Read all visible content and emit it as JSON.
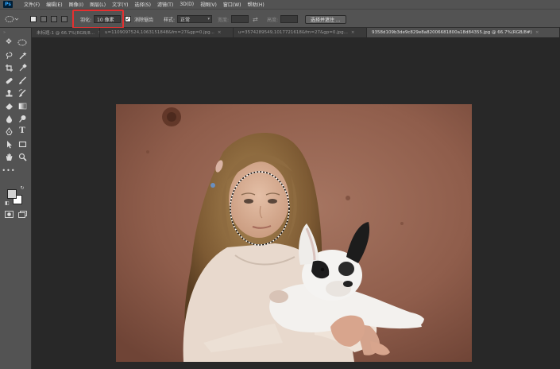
{
  "menu": {
    "app_logo": "Ps",
    "items": [
      "文件(F)",
      "编辑(E)",
      "图像(I)",
      "图层(L)",
      "文字(Y)",
      "选择(S)",
      "滤镜(T)",
      "3D(D)",
      "视图(V)",
      "窗口(W)",
      "帮助(H)"
    ]
  },
  "options": {
    "feather_label": "羽化:",
    "feather_value": "10 像素",
    "antialias_label": "消除锯齿",
    "antialias_checked": true,
    "style_label": "样式:",
    "style_value": "正常",
    "width_label": "宽度:",
    "height_label": "高度:",
    "select_mask_label": "选择并遮住 ..."
  },
  "tabs": [
    {
      "label": "未标题-1 @ 66.7%(RGB/8...",
      "active": false
    },
    {
      "label": "u=1109097524,1063151848&fm=27&gp=0.jpg...",
      "active": false
    },
    {
      "label": "u=3574289549,1017721618&fm=27&gp=0.jpg...",
      "active": false
    },
    {
      "label": "9358d109b3de9c829e8a82006681800a18d84355.jpg @ 66.7%(RGB/8#)",
      "active": true
    }
  ],
  "tools": [
    "move-icon",
    "marquee-ellipse-icon",
    "lasso-icon",
    "magic-wand-icon",
    "crop-icon",
    "eyedropper-icon",
    "healing-brush-icon",
    "brush-icon",
    "clone-stamp-icon",
    "history-brush-icon",
    "eraser-icon",
    "gradient-icon",
    "blur-icon",
    "dodge-icon",
    "pen-icon",
    "type-icon",
    "path-select-icon",
    "rectangle-icon",
    "hand-icon",
    "zoom-icon",
    "more-tools-icon"
  ],
  "colors": {
    "foreground": "#d2d2d2",
    "background": "#ffffff",
    "highlight_box": "#e53030",
    "ui_panel": "#535353",
    "workspace": "#282828"
  }
}
